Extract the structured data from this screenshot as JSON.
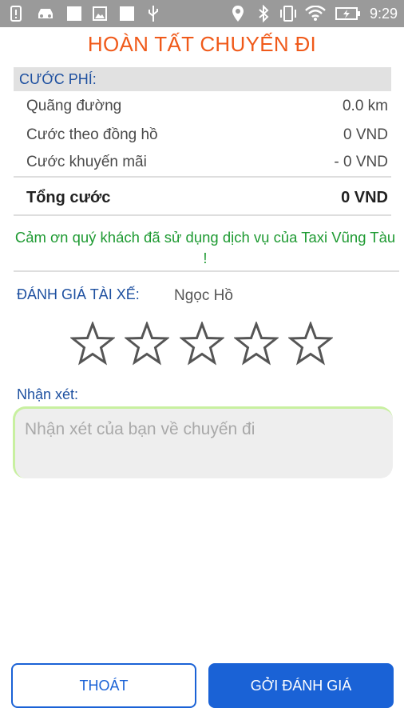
{
  "status_bar": {
    "time": "9:29",
    "icons": [
      "alert-icon",
      "car-icon",
      "square-icon",
      "image-icon",
      "square-icon",
      "usb-icon",
      "location-icon",
      "bluetooth-icon",
      "vibrate-icon",
      "wifi-icon",
      "battery-charging-icon"
    ]
  },
  "screen": {
    "title": "HOÀN TẤT CHUYẾN ĐI"
  },
  "fee": {
    "header": "CƯỚC PHÍ:",
    "rows": [
      {
        "label": "Quãng đường",
        "value": "0.0 km"
      },
      {
        "label": "Cước theo đồng hồ",
        "value": "0 VND"
      },
      {
        "label": "Cước khuyến mãi",
        "value": "- 0 VND"
      }
    ],
    "total": {
      "label": "Tổng cước",
      "value": "0 VND"
    }
  },
  "thanks_message": "Cảm ơn quý khách đã sử dụng dịch vụ của Taxi Vũng Tàu !",
  "rating": {
    "label": "ĐÁNH GIÁ TÀI XẾ:",
    "driver_name": "Ngọc Hồ",
    "stars_filled": 0,
    "stars_total": 5
  },
  "comment": {
    "label": "Nhận xét:",
    "placeholder": "Nhận xét của bạn về chuyến đi",
    "value": ""
  },
  "buttons": {
    "exit": "THOÁT",
    "submit": "GỞI ĐÁNH GIÁ"
  },
  "colors": {
    "title": "#f05a1a",
    "accent_blue": "#1a62d6",
    "label_blue": "#1e50a0",
    "thanks_green": "#1e9a32",
    "status_bar": "#9a9a9a"
  }
}
